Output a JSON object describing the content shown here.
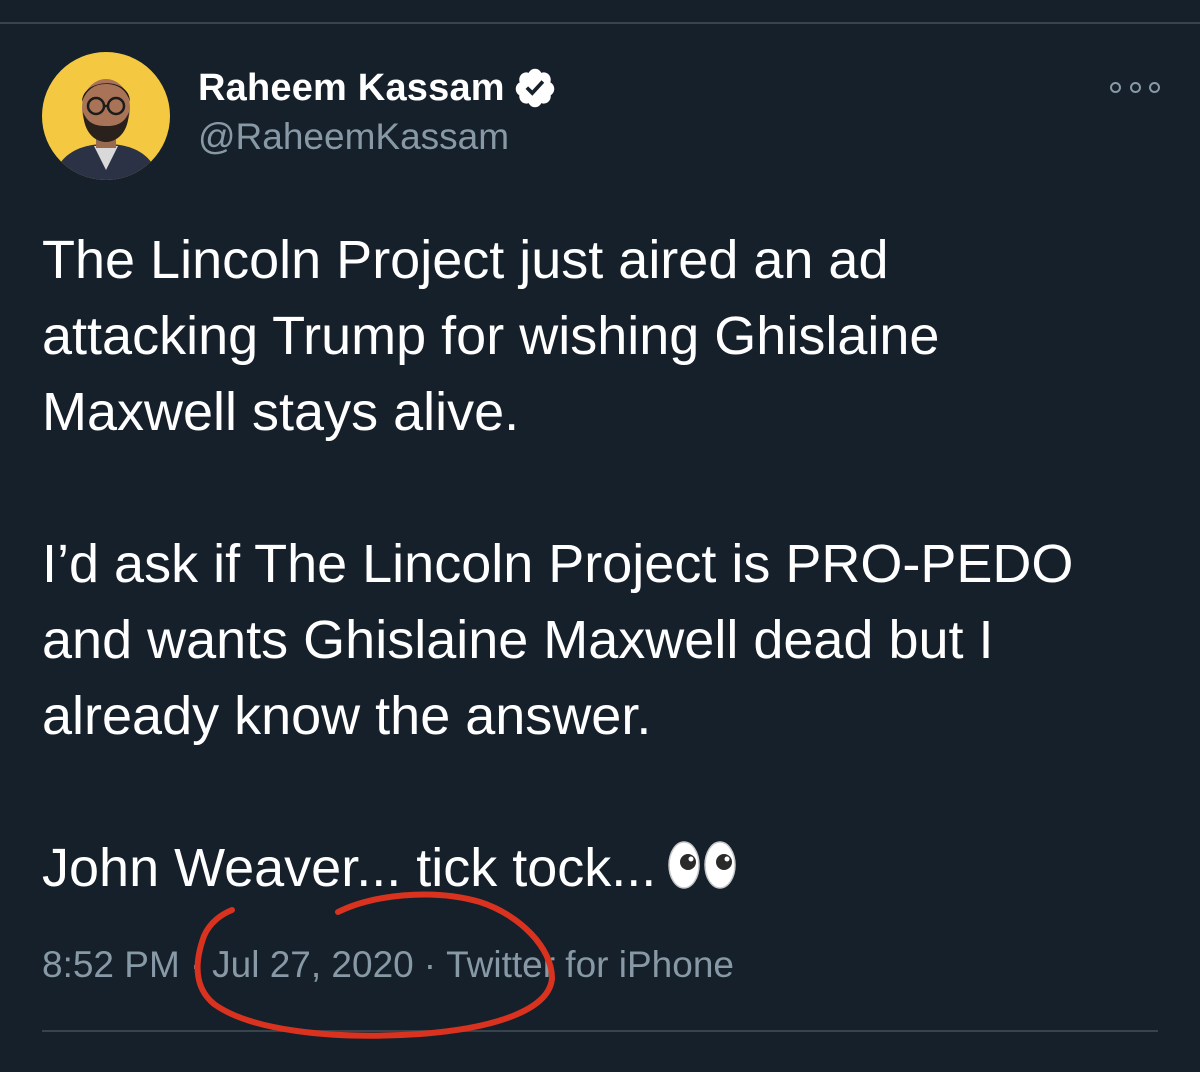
{
  "author": {
    "display_name": "Raheem Kassam",
    "handle": "@RaheemKassam",
    "verified": true,
    "avatar_bg_color": "#f5c842"
  },
  "tweet": {
    "lines": [
      "The Lincoln Project just aired an ad",
      "attacking Trump for wishing Ghislaine",
      "Maxwell stays alive.",
      "",
      "I’d ask if The Lincoln Project is PRO-PEDO",
      "and wants Ghislaine Maxwell dead but I",
      "already know the answer.",
      "",
      "John Weaver... tick tock..."
    ],
    "emoji": "eyes-emoji"
  },
  "meta": {
    "time": "8:52 PM",
    "date": "Jul 27, 2020",
    "source": "Twitter for iPhone",
    "separator": "·"
  },
  "colors": {
    "background": "#15202b",
    "text_primary": "#ffffff",
    "text_secondary": "#8899a6",
    "divider": "#38444d",
    "annotation": "#d9321f"
  }
}
